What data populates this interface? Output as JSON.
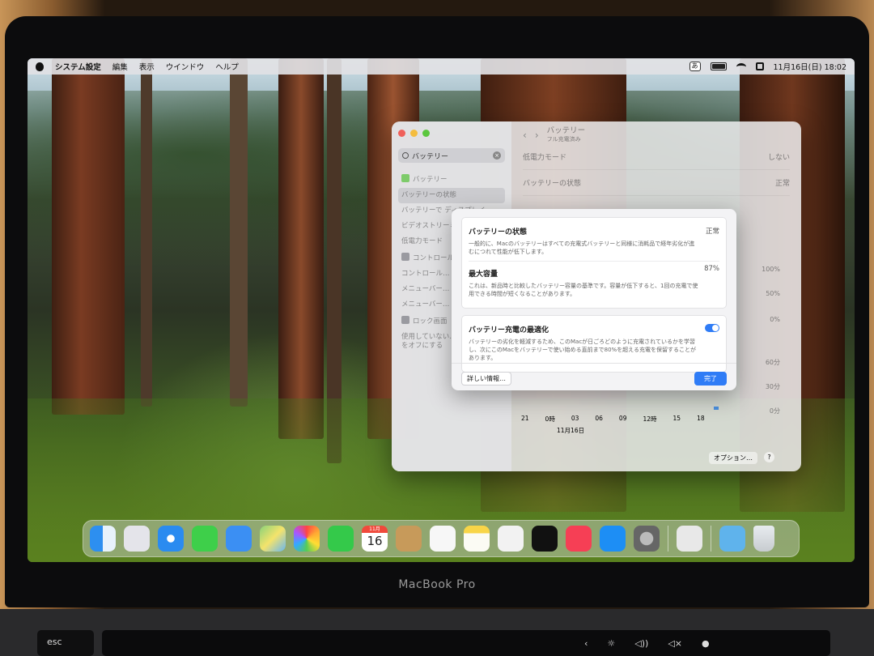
{
  "menubar": {
    "app_name": "システム設定",
    "items": [
      "編集",
      "表示",
      "ウインドウ",
      "ヘルプ"
    ],
    "ime": "あ",
    "datetime": "11月16日(日) 18:02"
  },
  "sidebar": {
    "search_value": "バッテリー",
    "items": [
      "バッテリー",
      "バッテリーの状態",
      "バッテリーで ディスプレイ…",
      "ビデオストリーミング 最適化",
      "低電力モード",
      "コントロール…",
      "コントロール… バッテリー…",
      "メニューバー… 状況を表示",
      "メニューバー… 残量を表示",
      "ロック画面",
      "使用していない… ディスプレイをオフにする"
    ]
  },
  "main": {
    "title": "バッテリー",
    "subtitle": "フル充電済み",
    "low_power_label": "低電力モード",
    "low_power_value": "しない",
    "health_label": "バッテリーの状態",
    "health_value": "正常",
    "pct_labels": [
      "100%",
      "50%",
      "0%"
    ],
    "min_labels": [
      "60分",
      "30分",
      "0分"
    ],
    "x_labels": [
      "21",
      "0時",
      "03",
      "06",
      "09",
      "12時",
      "15",
      "18"
    ],
    "x_date": "11月16日",
    "options_label": "オプション…",
    "help_label": "?"
  },
  "sheet": {
    "health_title": "バッテリーの状態",
    "health_value": "正常",
    "health_desc": "一般的に、Macのバッテリーはすべての充電式バッテリーと同様に消耗品で経年劣化が進むにつれて性能が低下します。",
    "capacity_title": "最大容量",
    "capacity_value": "87%",
    "capacity_desc": "これは、新品時と比較したバッテリー容量の基準です。容量が低下すると、1回の充電で使用できる時間が短くなることがあります。",
    "opt_title": "バッテリー充電の最適化",
    "opt_desc": "バッテリーの劣化を軽減するため、このMacが日ごろどのように充電されているかを学習し、次にこのMacをバッテリーで使い始める直前まで80%を超える充電を保留することがあります。",
    "more_label": "詳しい情報…",
    "done_label": "完了"
  },
  "dock": {
    "calendar_month": "11月",
    "calendar_day": "16"
  },
  "hardware": {
    "model": "MacBook Pro",
    "esc": "esc"
  }
}
